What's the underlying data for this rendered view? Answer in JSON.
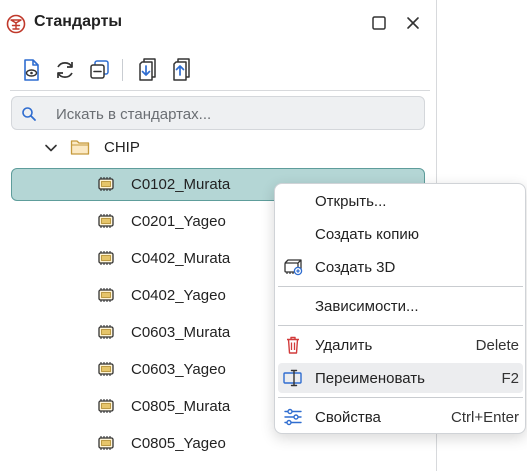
{
  "colors": {
    "accent": "#2f6dd0",
    "brand": "#c0392b",
    "selection_bg": "#b4d6d5",
    "selection_border": "#5e9d9b",
    "delete_icon": "#d23b3b",
    "chip_icon": "#c9a64a"
  },
  "window": {
    "title": "Стандарты",
    "app_icon": "standards-logo-icon",
    "maximize_icon": "maximize-icon",
    "close_icon": "close-icon"
  },
  "toolbar": {
    "buttons": [
      {
        "icon": "preview-document-icon"
      },
      {
        "icon": "refresh-icon"
      },
      {
        "icon": "collapse-all-icon"
      },
      {
        "icon": "import-icon"
      },
      {
        "icon": "export-icon"
      }
    ]
  },
  "search": {
    "placeholder": "Искать в стандартах...",
    "value": "",
    "icon": "search-icon"
  },
  "tree": {
    "folder": {
      "label": "CHIP",
      "expanded": true,
      "icon": "folder-icon"
    },
    "items": [
      {
        "label": "C0102_Murata",
        "selected": true,
        "icon": "chip-icon"
      },
      {
        "label": "C0201_Yageo",
        "selected": false,
        "icon": "chip-icon"
      },
      {
        "label": "C0402_Murata",
        "selected": false,
        "icon": "chip-icon"
      },
      {
        "label": "C0402_Yageo",
        "selected": false,
        "icon": "chip-icon"
      },
      {
        "label": "C0603_Murata",
        "selected": false,
        "icon": "chip-icon"
      },
      {
        "label": "C0603_Yageo",
        "selected": false,
        "icon": "chip-icon"
      },
      {
        "label": "C0805_Murata",
        "selected": false,
        "icon": "chip-icon"
      },
      {
        "label": "C0805_Yageo",
        "selected": false,
        "icon": "chip-icon"
      }
    ]
  },
  "context_menu": {
    "items": [
      {
        "label": "Открыть...",
        "shortcut": ""
      },
      {
        "label": "Создать копию",
        "shortcut": ""
      },
      {
        "label": "Создать 3D",
        "shortcut": "",
        "icon": "create-3d-icon"
      },
      {
        "label": "Зависимости...",
        "shortcut": ""
      },
      {
        "label": "Удалить",
        "shortcut": "Delete",
        "icon": "trash-icon"
      },
      {
        "label": "Переименовать",
        "shortcut": "F2",
        "icon": "rename-icon",
        "hovered": true
      },
      {
        "label": "Свойства",
        "shortcut": "Ctrl+Enter",
        "icon": "properties-sliders-icon"
      }
    ]
  }
}
